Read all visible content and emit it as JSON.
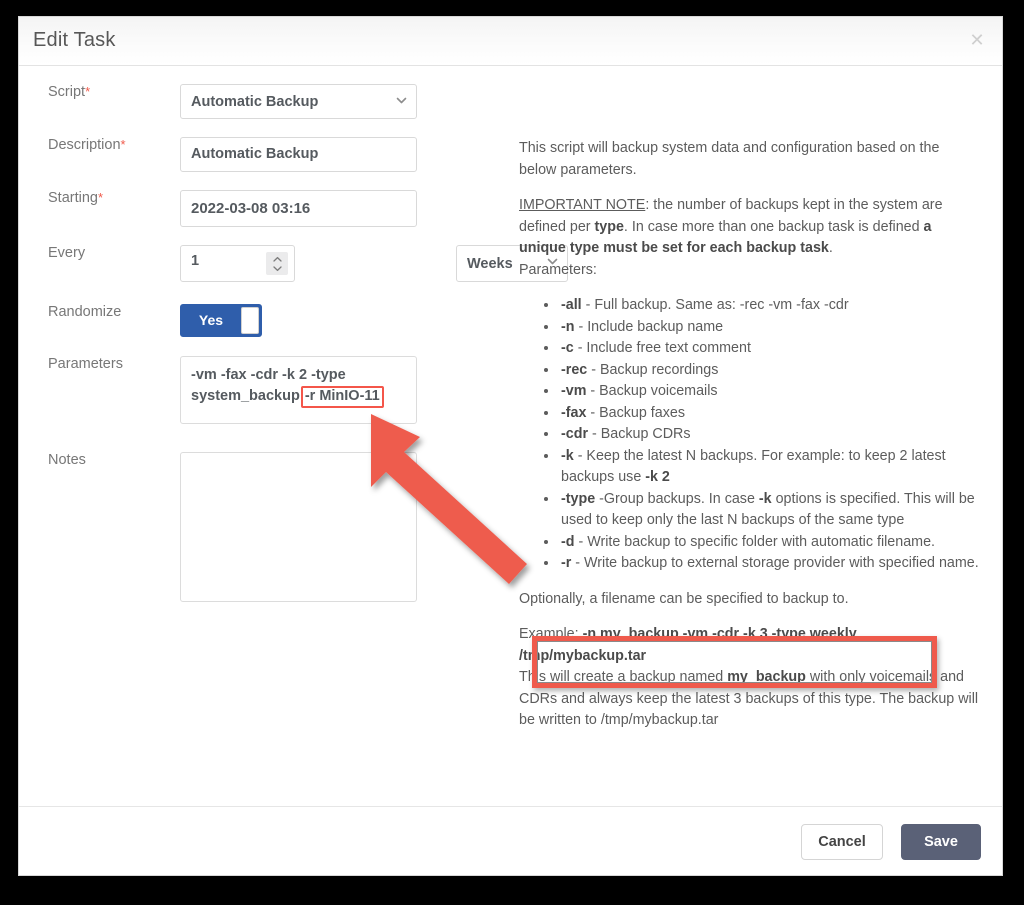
{
  "dialog": {
    "title": "Edit Task",
    "close_icon": "close-icon"
  },
  "form": {
    "script": {
      "label": "Script",
      "required_mark": "*",
      "value": "Automatic Backup",
      "icon": "chevron-down-icon"
    },
    "description": {
      "label": "Description",
      "required_mark": "*",
      "value": "Automatic Backup"
    },
    "starting": {
      "label": "Starting",
      "required_mark": "*",
      "value": "2022-03-08 03:16"
    },
    "every": {
      "label": "Every",
      "value": "1",
      "unit_value": "Weeks",
      "stepper_icon": "spinner-updown-icon",
      "unit_icon": "chevron-down-icon"
    },
    "randomize": {
      "label": "Randomize",
      "value": "Yes"
    },
    "parameters": {
      "label": "Parameters",
      "value_plain": "-vm -fax -cdr -k 2 -type system_backup",
      "value_highlight": "-r MinIO-11"
    },
    "notes": {
      "label": "Notes",
      "value": ""
    }
  },
  "help": {
    "intro": "This script will backup system data and configuration based on the below parameters.",
    "note_label": "IMPORTANT NOTE",
    "note_part1": ": the number of backups kept in the system are defined per ",
    "note_bold1": "type",
    "note_part2": ". In case more than one backup task is defined ",
    "note_bold2": "a unique type must be set for each backup task",
    "note_part3": ".",
    "parameters_label": "Parameters:",
    "items": [
      {
        "flag": "-all",
        "desc": " - Full backup. Same as: -rec -vm -fax -cdr"
      },
      {
        "flag": "-n",
        "desc": " - Include backup name"
      },
      {
        "flag": "-c",
        "desc": " - Include free text comment"
      },
      {
        "flag": "-rec",
        "desc": " - Backup recordings"
      },
      {
        "flag": "-vm",
        "desc": " - Backup voicemails"
      },
      {
        "flag": "-fax",
        "desc": " - Backup faxes"
      },
      {
        "flag": "-cdr",
        "desc": " - Backup CDRs"
      }
    ],
    "item_k": {
      "flag": "-k",
      "desc_a": " - Keep the latest N backups. For example: to keep 2 latest backups use ",
      "desc_b": "-k 2"
    },
    "item_type": {
      "flag": "-type",
      "desc_a": " -Group backups. In case ",
      "desc_b": "-k",
      "desc_c": " options is specified. This will be used to keep only the last N backups of the same type"
    },
    "item_d": {
      "flag": "-d",
      "desc": " - Write backup to specific folder with automatic filename."
    },
    "item_r": {
      "flag": "-r",
      "desc": " - Write backup to external storage provider with specified name."
    },
    "optional_line": "Optionally, a filename can be specified to backup to.",
    "example_label": "Example: ",
    "example_cmd": "-n my_backup -vm -cdr -k 3 -type weekly /tmp/mybackup.tar",
    "example_desc_a": "This will create a backup named ",
    "example_desc_bold": "my_backup",
    "example_desc_b": " with only voicemails and CDRs and always keep the latest 3 backups of this type. The backup will be written to /tmp/mybackup.tar"
  },
  "footer": {
    "cancel_label": "Cancel",
    "save_label": "Save"
  },
  "annotations": {
    "arrow_color": "#ee5c4e",
    "highlight_color": "#ef5a4c",
    "param_highlight_color": "#f4564a",
    "accent_blue": "#2f5eab",
    "save_button_color": "#5a6177"
  }
}
